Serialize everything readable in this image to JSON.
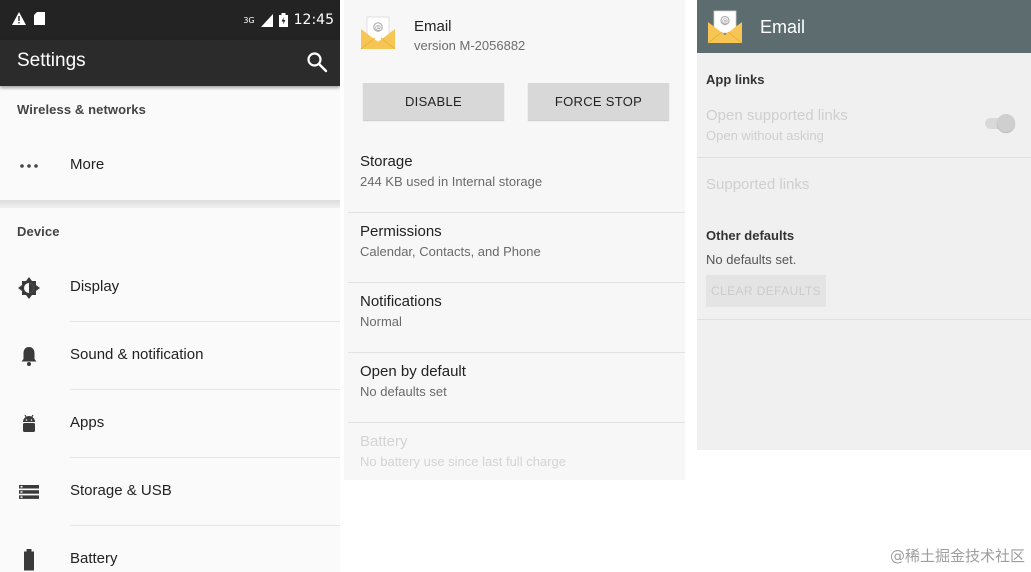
{
  "settings": {
    "status_time": "12:45",
    "status_network": "3G",
    "title": "Settings",
    "sections": {
      "wireless": "Wireless & networks",
      "device": "Device"
    },
    "wireless_items": [
      {
        "label": "More",
        "icon": "more-dots-icon"
      }
    ],
    "device_items": [
      {
        "label": "Display",
        "icon": "brightness-icon"
      },
      {
        "label": "Sound & notification",
        "icon": "bell-icon"
      },
      {
        "label": "Apps",
        "icon": "android-icon"
      },
      {
        "label": "Storage & USB",
        "icon": "storage-icon"
      },
      {
        "label": "Battery",
        "icon": "battery-icon"
      }
    ],
    "colors": {
      "status_bar": "#232323",
      "app_bar": "#2b2b2b"
    }
  },
  "app_info": {
    "app_name": "Email",
    "version": "version M-2056882",
    "buttons": {
      "disable": "DISABLE",
      "force_stop": "FORCE STOP"
    },
    "items": [
      {
        "title": "Storage",
        "summary": "244 KB used in Internal storage",
        "enabled": true
      },
      {
        "title": "Permissions",
        "summary": "Calendar, Contacts, and Phone",
        "enabled": true
      },
      {
        "title": "Notifications",
        "summary": "Normal",
        "enabled": true
      },
      {
        "title": "Open by default",
        "summary": "No defaults set",
        "enabled": true
      },
      {
        "title": "Battery",
        "summary": "No battery use since last full charge",
        "enabled": false
      }
    ]
  },
  "open_by_default": {
    "title": "Email",
    "app_links_header": "App links",
    "open_supported_links": {
      "title": "Open supported links",
      "summary": "Open without asking",
      "enabled": false,
      "checked": true
    },
    "supported_links": "Supported links",
    "other_defaults_header": "Other defaults",
    "no_defaults": "No defaults set.",
    "clear_defaults_button": "CLEAR DEFAULTS",
    "colors": {
      "app_bar": "#5d6d6f"
    }
  },
  "watermark": "@稀土掘金技术社区"
}
